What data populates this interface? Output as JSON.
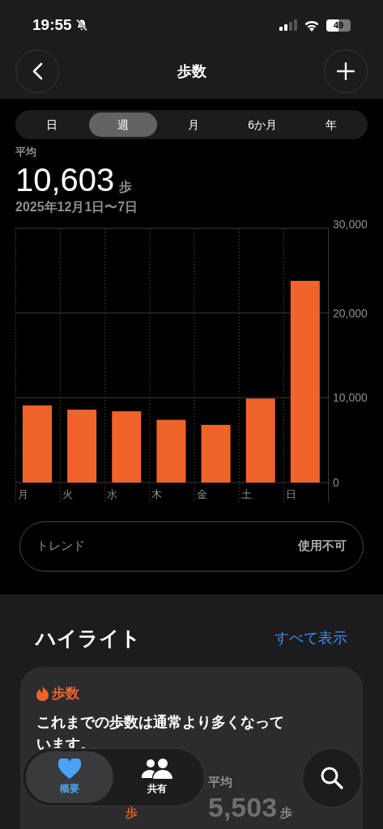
{
  "status_bar": {
    "time": "19:55",
    "battery": "49"
  },
  "nav": {
    "title": "歩数"
  },
  "periods": [
    {
      "label": "日",
      "selected": false
    },
    {
      "label": "週",
      "selected": true
    },
    {
      "label": "月",
      "selected": false
    },
    {
      "label": "6か月",
      "selected": false
    },
    {
      "label": "年",
      "selected": false
    }
  ],
  "summary": {
    "label": "平均",
    "value": "10,603",
    "unit": "歩",
    "range": "2025年12月1日〜7日"
  },
  "chart_data": {
    "type": "bar",
    "categories": [
      "月",
      "火",
      "水",
      "木",
      "金",
      "土",
      "日"
    ],
    "series": [
      {
        "color": "#f0642c",
        "values": [
          9100,
          8600,
          8400,
          7400,
          6800,
          9900,
          23800
        ]
      }
    ],
    "ylim": [
      0,
      30000
    ],
    "yticks": [
      {
        "value": 0,
        "label": "0"
      },
      {
        "value": 10000,
        "label": "10,000"
      },
      {
        "value": 20000,
        "label": "20,000"
      },
      {
        "value": 30000,
        "label": "30,000"
      }
    ]
  },
  "trend": {
    "label": "トレンド",
    "value": "使用不可"
  },
  "highlights": {
    "title": "ハイライト",
    "show_all": "すべて表示",
    "card": {
      "category": "歩数",
      "text": "これまでの歩数は通常より多くなっています。",
      "left_unit": "歩",
      "right_label": "平均",
      "right_value": "5,503",
      "right_unit": "歩"
    }
  },
  "tab_bar": [
    {
      "label": "概要",
      "selected": true,
      "kind": "heart"
    },
    {
      "label": "共有",
      "selected": false,
      "kind": "people"
    }
  ]
}
